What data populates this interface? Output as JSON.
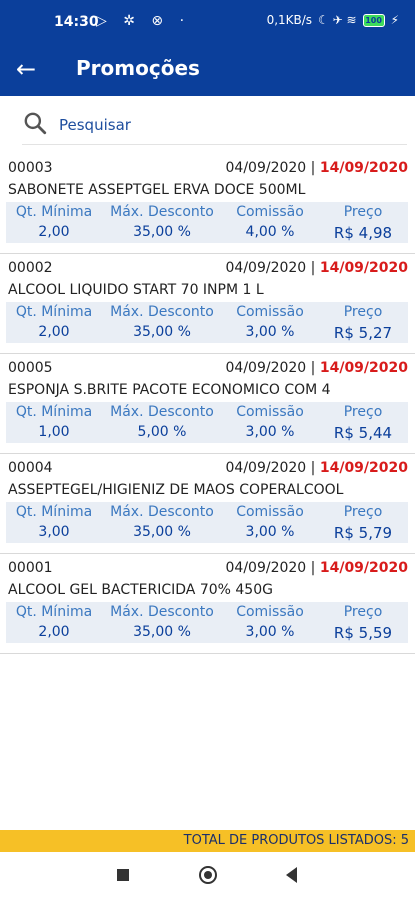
{
  "status_bar": {
    "time": "14:30",
    "left_icons": "▷ ✲ ⊗ ·",
    "network_speed": "0,1KB/s",
    "right_icons": "☾ ✈ ≋",
    "battery": "100",
    "charging": "⚡"
  },
  "app_bar": {
    "back_icon": "←",
    "title": "Promoções"
  },
  "search": {
    "placeholder": "Pesquisar"
  },
  "labels": {
    "min_qty": "Qt. Mínima",
    "max_discount": "Máx. Desconto",
    "commission": "Comissão",
    "price": "Preço",
    "date_separator": "|"
  },
  "items": [
    {
      "code": "00003",
      "start": "04/09/2020",
      "end": "14/09/2020",
      "name": "SABONETE ASSEPTGEL ERVA DOCE 500ML",
      "min_qty": "2,00",
      "max_discount": "35,00 %",
      "commission": "4,00 %",
      "price": "R$ 4,98"
    },
    {
      "code": "00002",
      "start": "04/09/2020",
      "end": "14/09/2020",
      "name": "ALCOOL LIQUIDO START 70 INPM 1 L",
      "min_qty": "2,00",
      "max_discount": "35,00 %",
      "commission": "3,00 %",
      "price": "R$ 5,27"
    },
    {
      "code": "00005",
      "start": "04/09/2020",
      "end": "14/09/2020",
      "name": "ESPONJA S.BRITE PACOTE ECONOMICO COM 4",
      "min_qty": "1,00",
      "max_discount": "5,00 %",
      "commission": "3,00 %",
      "price": "R$ 5,44"
    },
    {
      "code": "00004",
      "start": "04/09/2020",
      "end": "14/09/2020",
      "name": "ASSEPTEGEL/HIGIENIZ DE MAOS COPERALCOOL",
      "min_qty": "3,00",
      "max_discount": "35,00 %",
      "commission": "3,00 %",
      "price": "R$ 5,79"
    },
    {
      "code": "00001",
      "start": "04/09/2020",
      "end": "14/09/2020",
      "name": "ALCOOL GEL BACTERICIDA 70% 450G",
      "min_qty": "2,00",
      "max_discount": "35,00 %",
      "commission": "3,00 %",
      "price": "R$ 5,59"
    }
  ],
  "footer": {
    "total_text": "TOTAL DE PRODUTOS LISTADOS: 5"
  },
  "colors": {
    "primary": "#0b3f9b",
    "end_date": "#d81b1b",
    "footer_bg": "#f6c026",
    "detail_bg": "#e9eef5"
  }
}
